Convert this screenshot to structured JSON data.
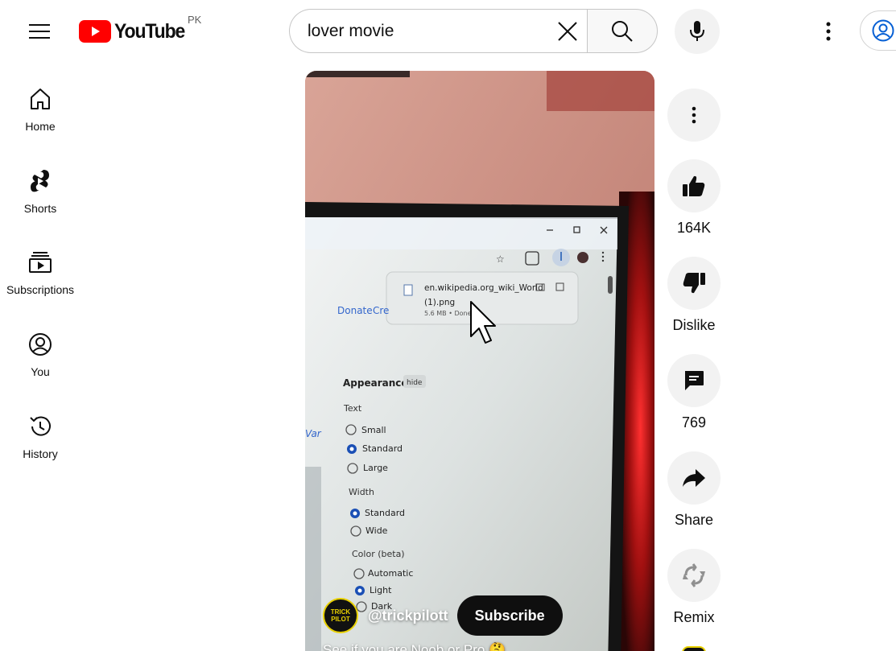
{
  "header": {
    "logo_text": "YouTube",
    "country_code": "PK",
    "search": {
      "value": "lover movie"
    }
  },
  "sidebar": {
    "items": [
      {
        "label": "Home",
        "icon": "home-icon"
      },
      {
        "label": "Shorts",
        "icon": "shorts-icon"
      },
      {
        "label": "Subscriptions",
        "icon": "subscriptions-icon"
      },
      {
        "label": "You",
        "icon": "account-icon"
      },
      {
        "label": "History",
        "icon": "history-icon"
      }
    ]
  },
  "video": {
    "channel_handle": "@trickpilott",
    "channel_avatar_text": [
      "TRICK",
      "PILOT"
    ],
    "subscribe_label": "Subscribe",
    "caption": "See if you are Noob or Pro 🤔",
    "screen_content": {
      "download_file": "en.wikipedia.org_wiki_World",
      "download_file_2": "(1).png",
      "download_meta": "5.6 MB • Done",
      "donate": "Donate",
      "create": "Cre",
      "appearance": "Appearance",
      "hide": "hide",
      "text_label": "Text",
      "text_options": [
        "Small",
        "Standard",
        "Large"
      ],
      "width_label": "Width",
      "width_options": [
        "Standard",
        "Wide"
      ],
      "color_label": "Color (beta)",
      "color_options": [
        "Automatic",
        "Light",
        "Dark"
      ],
      "var_text": "Var"
    }
  },
  "actions": {
    "like_count": "164K",
    "dislike_label": "Dislike",
    "comments_count": "769",
    "share_label": "Share",
    "remix_label": "Remix"
  },
  "colors": {
    "brand_red": "#ff0000",
    "button_bg": "#f2f2f2",
    "text": "#0f0f0f"
  }
}
